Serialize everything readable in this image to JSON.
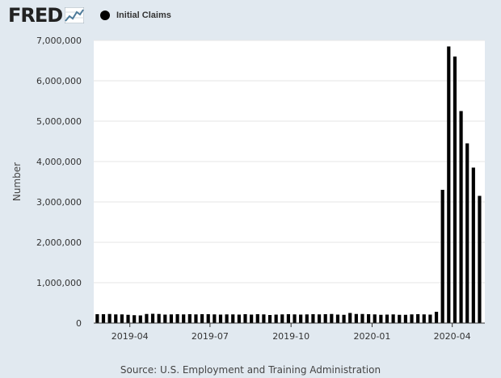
{
  "logo": {
    "text": "FRED",
    "graph_icon": "line-graph-icon"
  },
  "legend": {
    "series_label": "Initial Claims",
    "swatch_color": "#000000"
  },
  "source": "Source: U.S. Employment and Training Administration",
  "chart_data": {
    "type": "bar",
    "ylabel": "Number",
    "xlabel": "",
    "ylim": [
      0,
      7000000
    ],
    "y_ticks": [
      0,
      1000000,
      2000000,
      3000000,
      4000000,
      5000000,
      6000000,
      7000000
    ],
    "y_tick_labels": [
      "0",
      "1,000,000",
      "2,000,000",
      "3,000,000",
      "4,000,000",
      "5,000,000",
      "6,000,000",
      "7,000,000"
    ],
    "x_tick_labels": [
      "2019-04",
      "2019-07",
      "2019-10",
      "2020-01",
      "2020-04"
    ],
    "x_tick_dates": [
      "2019-04-01",
      "2019-07-01",
      "2019-10-01",
      "2020-01-01",
      "2020-04-01"
    ],
    "xlim": [
      "2019-02-19",
      "2020-05-08"
    ],
    "grid": true,
    "bar_color": "#000000",
    "series": [
      {
        "name": "Initial Claims",
        "x": [
          "2019-02-23",
          "2019-03-02",
          "2019-03-09",
          "2019-03-16",
          "2019-03-23",
          "2019-03-30",
          "2019-04-06",
          "2019-04-13",
          "2019-04-20",
          "2019-04-27",
          "2019-05-04",
          "2019-05-11",
          "2019-05-18",
          "2019-05-25",
          "2019-06-01",
          "2019-06-08",
          "2019-06-15",
          "2019-06-22",
          "2019-06-29",
          "2019-07-06",
          "2019-07-13",
          "2019-07-20",
          "2019-07-27",
          "2019-08-03",
          "2019-08-10",
          "2019-08-17",
          "2019-08-24",
          "2019-08-31",
          "2019-09-07",
          "2019-09-14",
          "2019-09-21",
          "2019-09-28",
          "2019-10-05",
          "2019-10-12",
          "2019-10-19",
          "2019-10-26",
          "2019-11-02",
          "2019-11-09",
          "2019-11-16",
          "2019-11-23",
          "2019-11-30",
          "2019-12-07",
          "2019-12-14",
          "2019-12-21",
          "2019-12-28",
          "2020-01-04",
          "2020-01-11",
          "2020-01-18",
          "2020-01-25",
          "2020-02-01",
          "2020-02-08",
          "2020-02-15",
          "2020-02-22",
          "2020-02-29",
          "2020-03-07",
          "2020-03-14",
          "2020-03-21",
          "2020-03-28",
          "2020-04-04",
          "2020-04-11",
          "2020-04-18",
          "2020-04-25",
          "2020-05-02"
        ],
        "values": [
          220000,
          220000,
          225000,
          215000,
          215000,
          205000,
          195000,
          190000,
          225000,
          230000,
          225000,
          210000,
          215000,
          220000,
          215000,
          220000,
          215000,
          220000,
          220000,
          215000,
          210000,
          215000,
          215000,
          210000,
          220000,
          210000,
          220000,
          215000,
          200000,
          210000,
          215000,
          220000,
          215000,
          210000,
          215000,
          220000,
          215000,
          220000,
          225000,
          210000,
          205000,
          250000,
          225000,
          225000,
          220000,
          215000,
          205000,
          210000,
          215000,
          205000,
          205000,
          215000,
          220000,
          215000,
          210000,
          280000,
          3300000,
          6850000,
          6600000,
          5250000,
          4450000,
          3850000,
          3150000
        ]
      }
    ]
  }
}
